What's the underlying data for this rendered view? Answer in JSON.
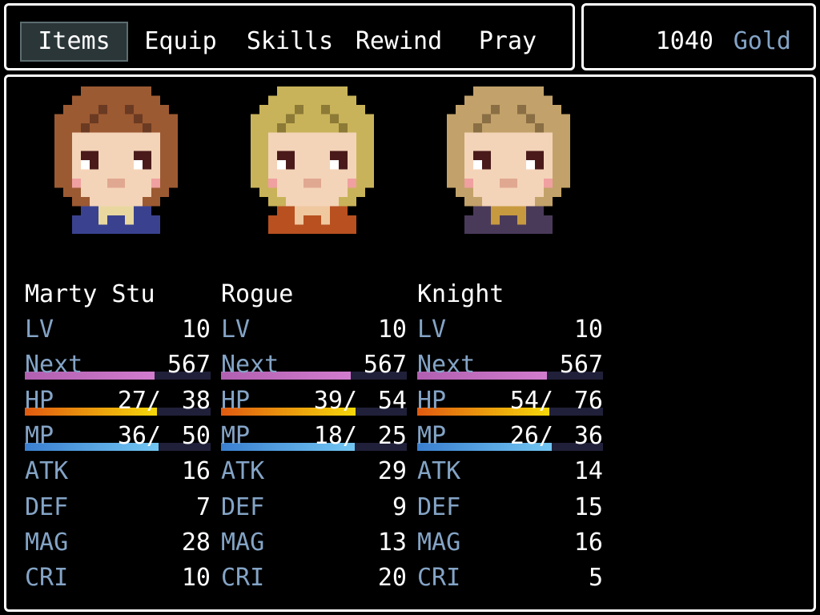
{
  "menu": {
    "commands": [
      "Items",
      "Equip",
      "Skills",
      "Rewind",
      "Pray"
    ],
    "selected_index": 0
  },
  "gold": {
    "amount": "1040",
    "unit": "Gold"
  },
  "labels": {
    "lv": "LV",
    "next": "Next",
    "hp": "HP",
    "mp": "MP",
    "atk": "ATK",
    "def": "DEF",
    "mag": "MAG",
    "cri": "CRI"
  },
  "actors": [
    {
      "name": "Marty Stu",
      "lv": "10",
      "next": "567",
      "next_ratio": 0.7,
      "hp": "27/",
      "mhp": "38",
      "mp": "36/",
      "mmp": "50",
      "atk": "16",
      "def": "7",
      "mag": "28",
      "cri": "10",
      "hair": "#9c5a32",
      "hair_dark": "#6b3a22",
      "outfit": "#3a4290",
      "accent": "#e8d8a0"
    },
    {
      "name": "Rogue",
      "lv": "10",
      "next": "567",
      "next_ratio": 0.7,
      "hp": "39/",
      "mhp": "54",
      "mp": "18/",
      "mmp": "25",
      "atk": "29",
      "def": "9",
      "mag": "13",
      "cri": "20",
      "hair": "#c9b35a",
      "hair_dark": "#8c7a36",
      "outfit": "#b85020",
      "accent": "#f0c8a0"
    },
    {
      "name": "Knight",
      "lv": "10",
      "next": "567",
      "next_ratio": 0.7,
      "hp": "54/",
      "mhp": "76",
      "mp": "26/",
      "mmp": "36",
      "atk": "14",
      "def": "15",
      "mag": "16",
      "cri": "5",
      "hair": "#c2a26a",
      "hair_dark": "#8a6e44",
      "outfit": "#4a3a5a",
      "accent": "#c89a40"
    }
  ]
}
